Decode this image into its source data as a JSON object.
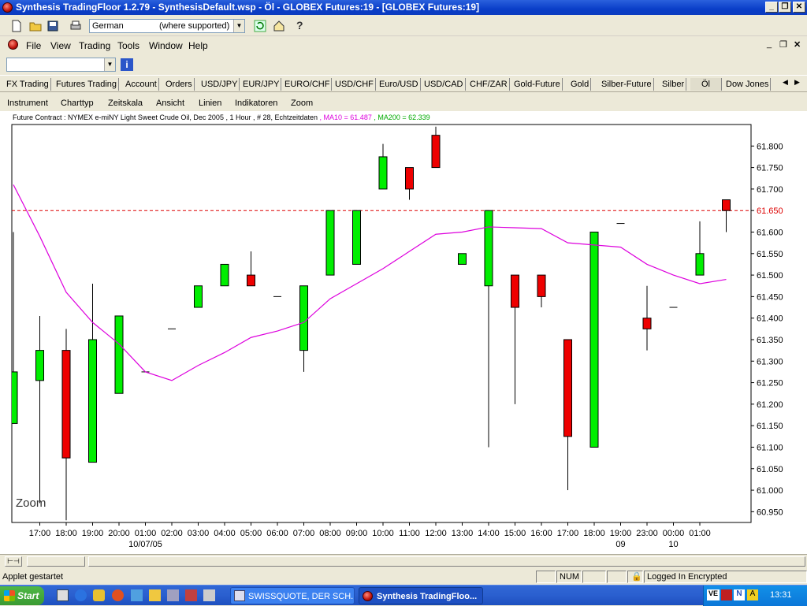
{
  "window": {
    "title": "Synthesis TradingFloor 1.2.79 - SynthesisDefault.wsp - Öl - GLOBEX Futures:19 - [GLOBEX Futures:19]"
  },
  "toolbar": {
    "language": "German",
    "language_note": "(where supported)"
  },
  "menu": [
    "File",
    "View",
    "Trading",
    "Tools",
    "Window",
    "Help"
  ],
  "search": {
    "value": ""
  },
  "tabs": [
    {
      "label": "FX Trading"
    },
    {
      "label": "Futures Trading"
    },
    {
      "label": "Account"
    },
    {
      "label": "Orders"
    },
    {
      "label": "USD/JPY"
    },
    {
      "label": "EUR/JPY"
    },
    {
      "label": "EURO/CHF"
    },
    {
      "label": "USD/CHF"
    },
    {
      "label": "Euro/USD"
    },
    {
      "label": "USD/CAD"
    },
    {
      "label": "CHF/ZAR"
    },
    {
      "label": "Gold-Future"
    },
    {
      "label": "Gold"
    },
    {
      "label": "Silber-Future"
    },
    {
      "label": "Silber"
    },
    {
      "label": "Öl"
    },
    {
      "label": "Dow Jones"
    }
  ],
  "chart_menu": [
    "Instrument",
    "Charttyp",
    "Zeitskala",
    "Ansicht",
    "Linien",
    "Indikatoren",
    "Zoom"
  ],
  "chart_info": {
    "contract": "Future Contract : NYMEX e-miNY Light Sweet Crude Oil, Dec 2005 , 1 Hour , # 28, Echtzeitdaten",
    "ma10": ", MA10 = 61.487",
    "ma200": ", MA200 = 62.339",
    "zoom_label": "Zoom"
  },
  "colors": {
    "up": "#00ee00",
    "down": "#ee0000",
    "ma": "#dd00dd",
    "ma200_text": "#00aa00",
    "level_line": "#dd0000"
  },
  "chart_data": {
    "type": "candlestick",
    "ylim": [
      60.925,
      61.85
    ],
    "yticks": [
      "61.800",
      "61.750",
      "61.700",
      "61.650",
      "61.600",
      "61.550",
      "61.500",
      "61.450",
      "61.400",
      "61.350",
      "61.300",
      "61.250",
      "61.200",
      "61.150",
      "61.100",
      "61.050",
      "61.000",
      "60.950"
    ],
    "reference_line": 61.65,
    "xlabels": [
      "17:00",
      "18:00",
      "19:00",
      "20:00",
      "01:00",
      "02:00",
      "03:00",
      "04:00",
      "05:00",
      "06:00",
      "07:00",
      "08:00",
      "09:00",
      "10:00",
      "11:00",
      "12:00",
      "13:00",
      "14:00",
      "15:00",
      "16:00",
      "17:00",
      "18:00",
      "19:00",
      "23:00",
      "00:00",
      "01:00"
    ],
    "date_labels": [
      "10/07/05",
      "09",
      "10"
    ],
    "candles": [
      {
        "x": "16:00",
        "open": 61.155,
        "close": 61.275,
        "high": 61.6,
        "low": 61.155
      },
      {
        "x": "17:00",
        "open": 61.255,
        "close": 61.325,
        "high": 61.405,
        "low": 60.97
      },
      {
        "x": "18:00",
        "open": 61.325,
        "close": 61.075,
        "high": 61.375,
        "low": 60.93
      },
      {
        "x": "19:00",
        "open": 61.065,
        "close": 61.35,
        "high": 61.48,
        "low": 61.065
      },
      {
        "x": "20:00",
        "open": 61.225,
        "close": 61.405,
        "high": 61.405,
        "low": 61.225
      },
      {
        "x": "01:00",
        "open": 61.275,
        "close": 61.275,
        "high": 61.275,
        "low": 61.275
      },
      {
        "x": "02:00",
        "open": 61.375,
        "close": 61.375,
        "high": 61.375,
        "low": 61.375
      },
      {
        "x": "03:00",
        "open": 61.425,
        "close": 61.475,
        "high": 61.475,
        "low": 61.425
      },
      {
        "x": "04:00",
        "open": 61.475,
        "close": 61.525,
        "high": 61.525,
        "low": 61.475
      },
      {
        "x": "05:00",
        "open": 61.5,
        "close": 61.475,
        "high": 61.555,
        "low": 61.475
      },
      {
        "x": "06:00",
        "open": 61.45,
        "close": 61.45,
        "high": 61.45,
        "low": 61.45
      },
      {
        "x": "07:00",
        "open": 61.325,
        "close": 61.475,
        "high": 61.475,
        "low": 61.275
      },
      {
        "x": "08:00",
        "open": 61.5,
        "close": 61.65,
        "high": 61.65,
        "low": 61.5
      },
      {
        "x": "09:00",
        "open": 61.525,
        "close": 61.65,
        "high": 61.65,
        "low": 61.525
      },
      {
        "x": "10:00",
        "open": 61.7,
        "close": 61.775,
        "high": 61.805,
        "low": 61.7
      },
      {
        "x": "11:00",
        "open": 61.75,
        "close": 61.7,
        "high": 61.75,
        "low": 61.675
      },
      {
        "x": "12:00",
        "open": 61.825,
        "close": 61.75,
        "high": 61.845,
        "low": 61.75
      },
      {
        "x": "13:00",
        "open": 61.525,
        "close": 61.55,
        "high": 61.55,
        "low": 61.525
      },
      {
        "x": "14:00",
        "open": 61.475,
        "close": 61.65,
        "high": 61.65,
        "low": 61.1
      },
      {
        "x": "15:00",
        "open": 61.5,
        "close": 61.425,
        "high": 61.5,
        "low": 61.2
      },
      {
        "x": "16:00",
        "open": 61.5,
        "close": 61.45,
        "high": 61.5,
        "low": 61.425
      },
      {
        "x": "17:00",
        "open": 61.35,
        "close": 61.125,
        "high": 61.35,
        "low": 61.0
      },
      {
        "x": "18:00",
        "open": 61.1,
        "close": 61.6,
        "high": 61.6,
        "low": 61.1
      },
      {
        "x": "19:00",
        "open": 61.62,
        "close": 61.62,
        "high": 61.62,
        "low": 61.62
      },
      {
        "x": "23:00",
        "open": 61.4,
        "close": 61.375,
        "high": 61.475,
        "low": 61.325
      },
      {
        "x": "00:00",
        "open": 61.425,
        "close": 61.425,
        "high": 61.425,
        "low": 61.425
      },
      {
        "x": "01:00",
        "open": 61.5,
        "close": 61.55,
        "high": 61.625,
        "low": 61.5
      },
      {
        "x": "02:00",
        "open": 61.675,
        "close": 61.65,
        "high": 61.675,
        "low": 61.6
      }
    ],
    "ma10": [
      61.71,
      61.59,
      61.46,
      61.39,
      61.34,
      61.275,
      61.255,
      61.29,
      61.32,
      61.355,
      61.37,
      61.39,
      61.445,
      61.48,
      61.515,
      61.555,
      61.595,
      61.6,
      61.612,
      61.61,
      61.608,
      61.575,
      61.57,
      61.565,
      61.525,
      61.5,
      61.48,
      61.49
    ]
  },
  "status": {
    "message": "Applet gestartet",
    "num": "NUM",
    "login": "Logged In Encrypted"
  },
  "taskbar": {
    "start": "Start",
    "tasks": [
      "SWISSQUOTE, DER SCH...",
      "Synthesis TradingFloo..."
    ],
    "clock": "13:31"
  }
}
